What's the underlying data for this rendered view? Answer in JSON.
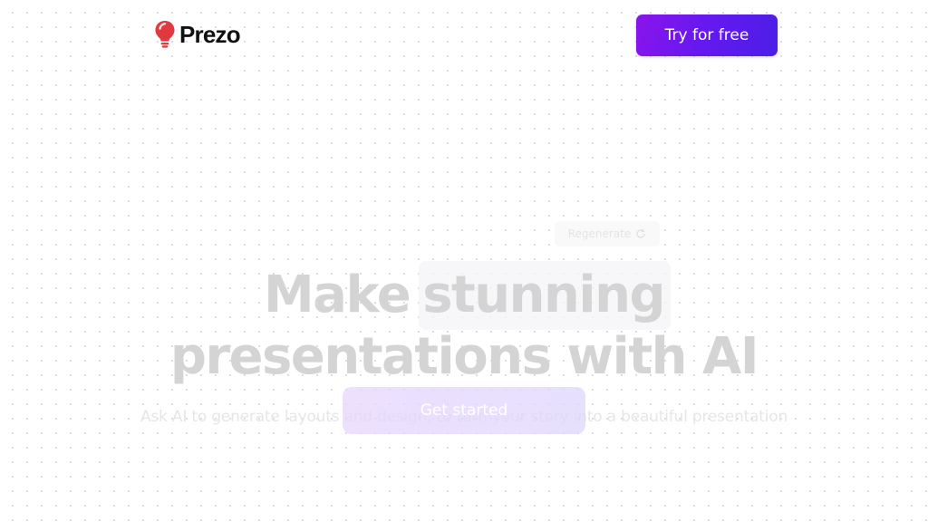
{
  "brand": {
    "name": "Prezo",
    "logo_icon": "lightbulb-icon",
    "logo_color": "#e0393e"
  },
  "header": {
    "cta_label": "Try for free",
    "cta_gradient": [
      "#8a14ec",
      "#4b1ee6"
    ]
  },
  "hero": {
    "regenerate_label": "Regenerate",
    "regenerate_icon": "refresh-icon",
    "headline_line1_word1": "Make",
    "headline_line1_word2": "stunning",
    "headline_line2": "presentations with AI",
    "subtitle": "Ask AI to generate layouts and design, to turn your story into a beautiful presentation",
    "primary_button_label": "Get started"
  }
}
